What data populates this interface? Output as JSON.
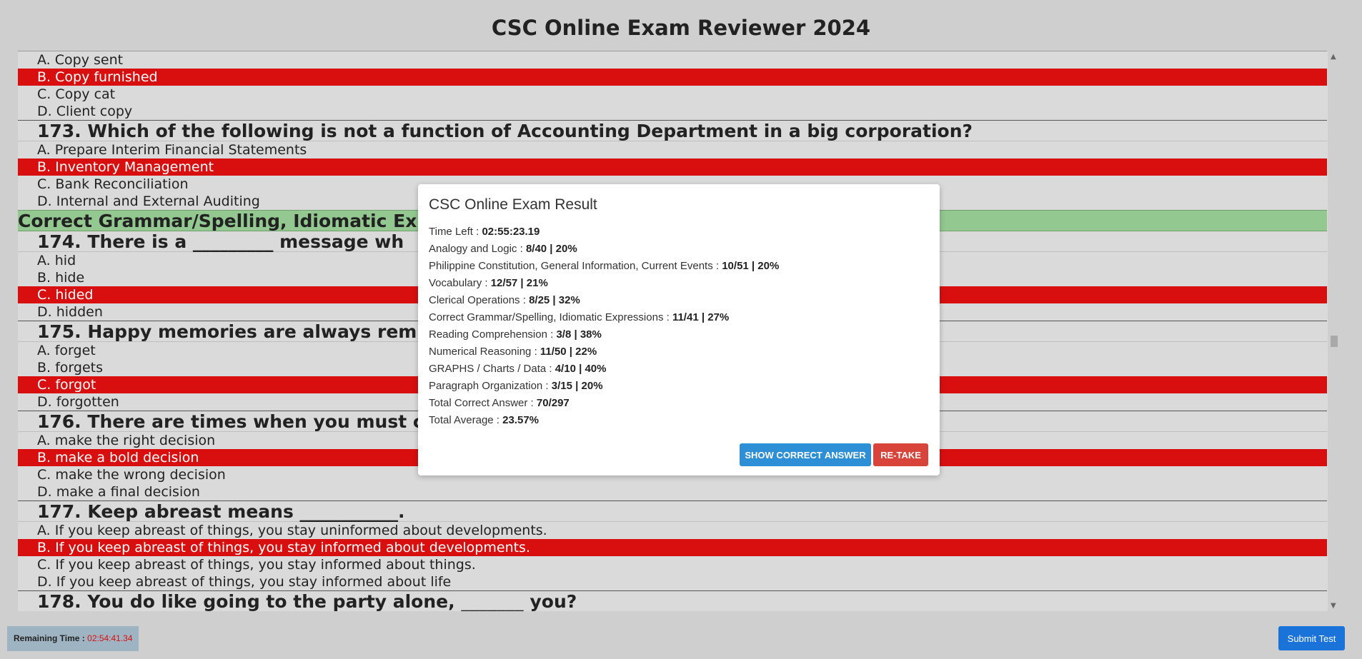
{
  "header": {
    "title": "CSC Online Exam Reviewer 2024"
  },
  "exam": {
    "q172_options": [
      "A. Copy sent",
      "B. Copy furnished",
      "C. Copy cat",
      "D. Client copy"
    ],
    "q173": {
      "text": "173. Which of the following is not a function of Accounting Department in a big corporation?",
      "options": [
        "A. Prepare Interim Financial Statements",
        "B. Inventory Management",
        "C. Bank Reconciliation",
        "D. Internal and External Auditing"
      ]
    },
    "section_header": "Correct Grammar/Spelling, Idiomatic Expressions",
    "q174": {
      "text": "174. There is a _________ message wh",
      "options": [
        "A. hid",
        "B. hide",
        "C. hided",
        "D. hidden"
      ]
    },
    "q175": {
      "text": "175. Happy memories are always rem",
      "options": [
        "A. forget",
        "B. forgets",
        "C. forgot",
        "D. forgotten"
      ]
    },
    "q176": {
      "text": "176. There are times when you must c",
      "options": [
        "A. make the right decision",
        "B. make a bold decision",
        "C. make the wrong decision",
        "D. make a final decision"
      ]
    },
    "q177": {
      "text": "177. Keep abreast means ___________.",
      "options": [
        "A. If you keep abreast of things, you stay uninformed about developments.",
        "B. If you keep abreast of things, you stay informed about developments.",
        "C. If you keep abreast of things, you stay informed about things.",
        "D. If you keep abreast of things, you stay informed about life"
      ]
    },
    "q178": {
      "text": "178. You do like going to the party alone, _______ you?"
    }
  },
  "modal": {
    "title": "CSC Online Exam Result",
    "rows": [
      {
        "label": "Time Left : ",
        "value": "02:55:23.19"
      },
      {
        "label": "Analogy and Logic : ",
        "value": "8/40 | 20%"
      },
      {
        "label": "Philippine Constitution, General Information, Current Events : ",
        "value": "10/51 | 20%"
      },
      {
        "label": "Vocabulary : ",
        "value": "12/57 | 21%"
      },
      {
        "label": "Clerical Operations : ",
        "value": "8/25 | 32%"
      },
      {
        "label": "Correct Grammar/Spelling, Idiomatic Expressions : ",
        "value": "11/41 | 27%"
      },
      {
        "label": "Reading Comprehension : ",
        "value": "3/8 | 38%"
      },
      {
        "label": "Numerical Reasoning : ",
        "value": "11/50 | 22%"
      },
      {
        "label": "GRAPHS / Charts / Data : ",
        "value": "4/10 | 40%"
      },
      {
        "label": "Paragraph Organization : ",
        "value": "3/15 | 20%"
      },
      {
        "label": "Total Correct Answer : ",
        "value": "70/297"
      },
      {
        "label": "Total Average : ",
        "value": "23.57%"
      }
    ],
    "show_answer_label": "SHOW CORRECT ANSWER",
    "retake_label": "RE-TAKE"
  },
  "footer": {
    "remaining_label": "Remaining Time : ",
    "remaining_value": "02:54:41.34",
    "submit_label": "Submit Test"
  },
  "colors": {
    "selected": "#d90f0f",
    "section": "#93c890",
    "primary": "#1a73d9",
    "danger": "#d9443a"
  }
}
